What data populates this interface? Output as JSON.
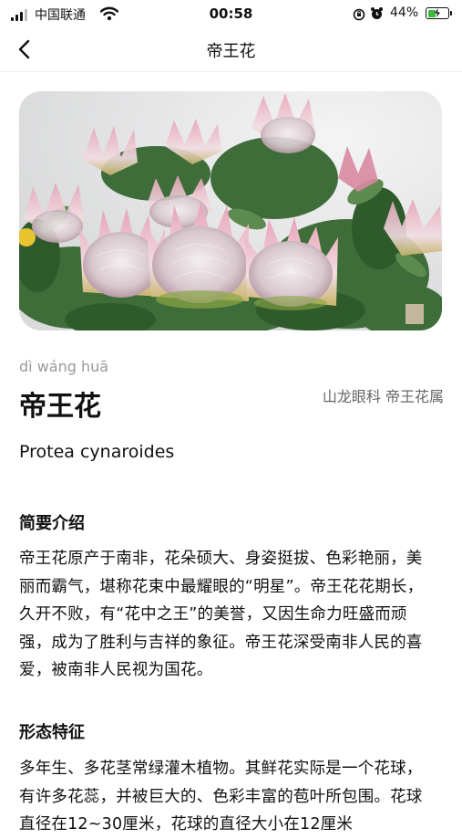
{
  "status": {
    "carrier": "中国联通",
    "time": "00:58",
    "battery": "44%",
    "battery_level": 0.44
  },
  "nav": {
    "title": "帝王花",
    "back_icon": "chevron-left-icon"
  },
  "plant": {
    "pinyin": "dì wáng huā",
    "name": "帝王花",
    "family": "山龙眼科 帝王花属",
    "latin": "Protea cynaroides"
  },
  "sections": [
    {
      "title": "简要介绍",
      "body": "帝王花原产于南非，花朵硕大、身姿挺拔、色彩艳丽，美丽而霸气，堪称花束中最耀眼的“明星”。帝王花花期长，久开不败，有“花中之王”的美誉，又因生命力旺盛而顽强，成为了胜利与吉祥的象征。帝王花深受南非人民的喜爱，被南非人民视为国花。"
    },
    {
      "title": "形态特征",
      "body": "多年生、多花茎常绿灌木植物。其鲜花实际是一个花球，有许多花蕊，并被巨大的、色彩丰富的苞叶所包围。花球直径在12~30厘米，花球的直径大小在12厘米"
    }
  ]
}
